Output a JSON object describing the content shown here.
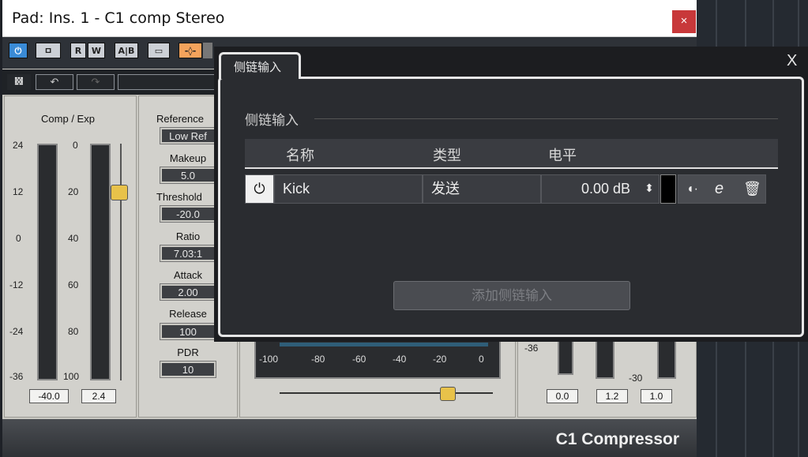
{
  "window": {
    "title": "Pad: Ins. 1 - C1 comp Stereo",
    "close_label": "×"
  },
  "toolbar": {
    "buttons": [
      "⏻",
      "ㅁ",
      "R",
      "W",
      "A|B",
      "▭",
      "-◊-"
    ]
  },
  "comp_exp": {
    "label": "Comp / Exp",
    "left_scale": [
      "24",
      "12",
      "0",
      "-12",
      "-24",
      "-36"
    ],
    "right_scale": [
      "0",
      "20",
      "40",
      "60",
      "80",
      "100"
    ],
    "left_value": "-40.0",
    "right_value": "2.4"
  },
  "params": {
    "reference_label": "Reference",
    "reference_value": "Low Ref",
    "makeup_label": "Makeup",
    "makeup_value": "5.0",
    "threshold_label": "Threshold",
    "threshold_value": "-20.0",
    "ratio_label": "Ratio",
    "ratio_value": "7.03:1",
    "attack_label": "Attack",
    "attack_value": "2.00",
    "release_label": "Release",
    "release_value": "100",
    "pdr_label": "PDR",
    "pdr_value": "10"
  },
  "meter_scale": [
    "-100",
    "-80",
    "-60",
    "-40",
    "-20",
    "0"
  ],
  "right_panel": {
    "tick_36": "-36",
    "tick_30": "-30",
    "val1": "0.0",
    "val2": "1.2",
    "val3": "1.0"
  },
  "footer": {
    "brand": "C1 Compressor"
  },
  "sidechain": {
    "tab_label": "侧链输入",
    "close_label": "X",
    "section_title": "侧链输入",
    "columns": [
      "名称",
      "类型",
      "电平"
    ],
    "rows": [
      {
        "name": "Kick",
        "type": "发送",
        "level": "0.00 dB"
      }
    ],
    "add_button": "添加侧链输入"
  },
  "colors": {
    "accent_blue": "#3a8bd6",
    "close_red": "#c8383a",
    "dialog_bg": "#2a2c30"
  }
}
